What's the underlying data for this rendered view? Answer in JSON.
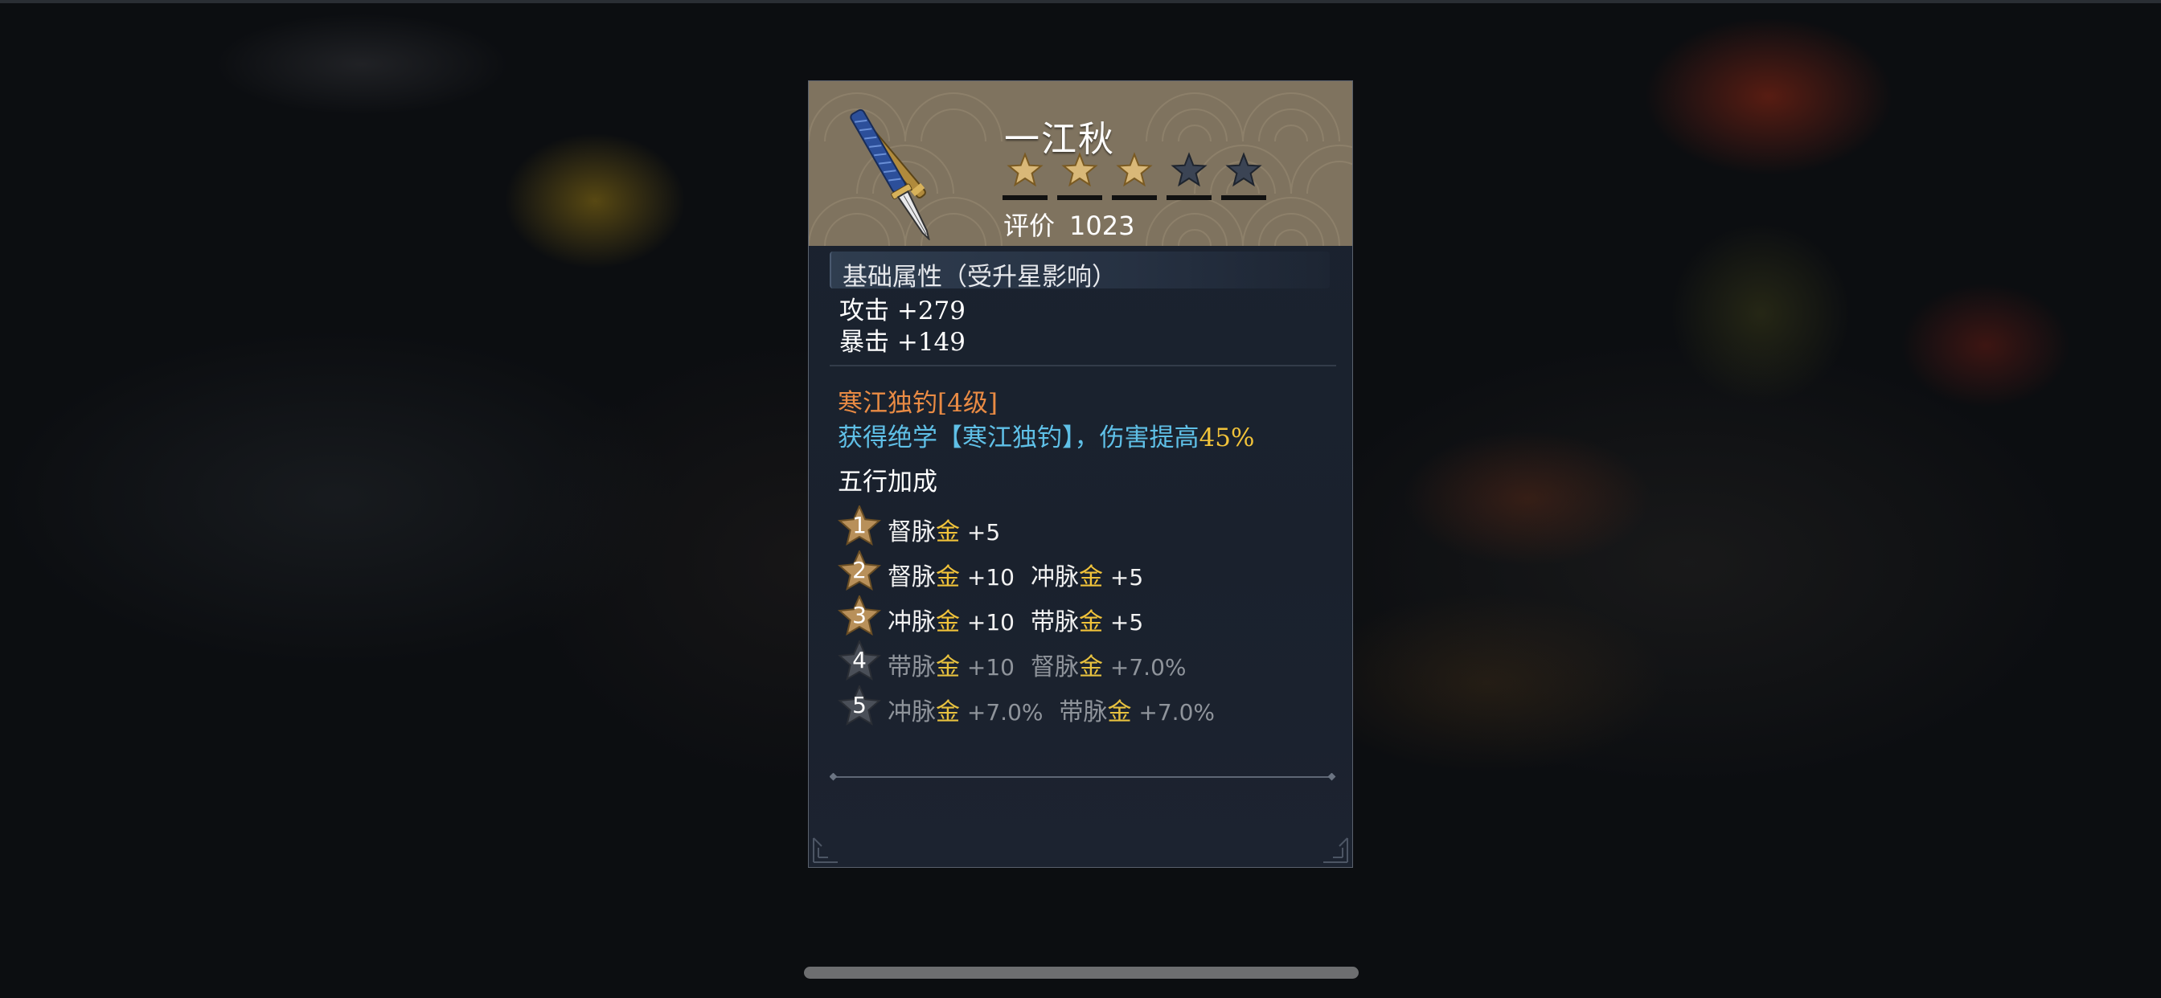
{
  "item": {
    "name": "一江秋",
    "stars_total": 5,
    "stars_filled": 3,
    "rating_label": "评价",
    "rating_value": "1023"
  },
  "base": {
    "title": "基础属性（受升星影响）",
    "stats": [
      {
        "text": "攻击 +279"
      },
      {
        "text": "暴击 +149"
      }
    ]
  },
  "skill": {
    "name": "寒江独钓[4级]",
    "desc_prefix": "获得绝学【寒江独钓】，伤害提高",
    "desc_pct": "45%"
  },
  "wuxing": {
    "title": "五行加成",
    "rows": [
      {
        "level": "1",
        "active": true,
        "entries": [
          {
            "name": "督脉",
            "elem": "金",
            "val": "+5"
          }
        ]
      },
      {
        "level": "2",
        "active": true,
        "entries": [
          {
            "name": "督脉",
            "elem": "金",
            "val": "+10"
          },
          {
            "name": "冲脉",
            "elem": "金",
            "val": "+5"
          }
        ]
      },
      {
        "level": "3",
        "active": true,
        "entries": [
          {
            "name": "冲脉",
            "elem": "金",
            "val": "+10"
          },
          {
            "name": "带脉",
            "elem": "金",
            "val": "+5"
          }
        ]
      },
      {
        "level": "4",
        "active": false,
        "entries": [
          {
            "name": "带脉",
            "elem": "金",
            "val": "+10"
          },
          {
            "name": "督脉",
            "elem": "金",
            "val": "+7.0%"
          }
        ]
      },
      {
        "level": "5",
        "active": false,
        "entries": [
          {
            "name": "冲脉",
            "elem": "金",
            "val": "+7.0%"
          },
          {
            "name": "带脉",
            "elem": "金",
            "val": "+7.0%"
          }
        ]
      }
    ]
  },
  "colors": {
    "header_bg": "#7f735f",
    "card_bg": "#1b2330",
    "skill_name": "#e98b44",
    "skill_desc": "#5fc0e7",
    "highlight": "#f1c33a",
    "star_active": "#c8a46a",
    "star_inactive": "#3b4454"
  },
  "icons": {
    "weapon": "blue-wrapped-blade-icon",
    "star": "star-icon"
  }
}
